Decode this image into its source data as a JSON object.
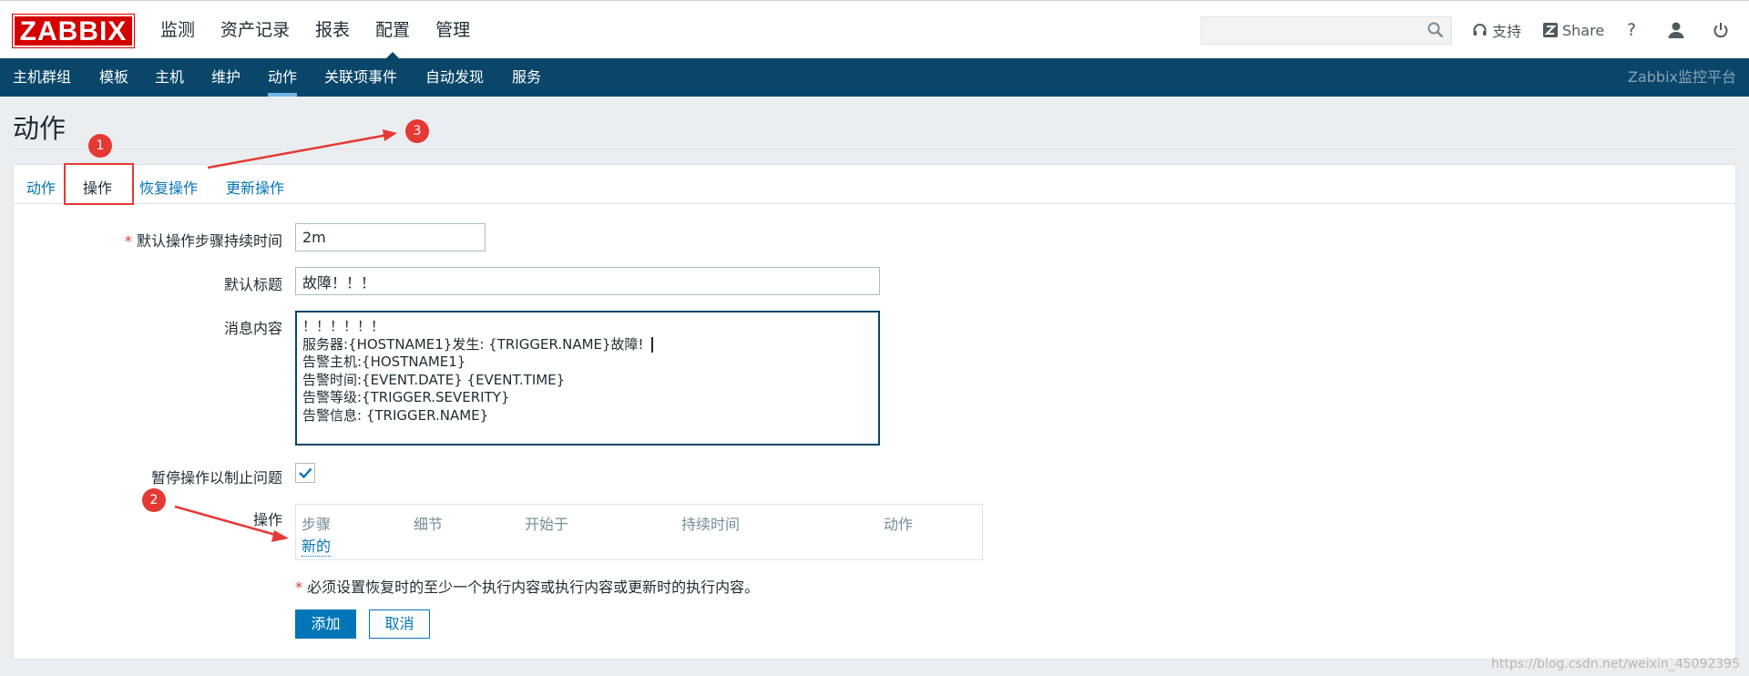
{
  "logo": "ZABBIX",
  "main_menu": [
    "监测",
    "资产记录",
    "报表",
    "配置",
    "管理"
  ],
  "main_menu_active": "配置",
  "search": {
    "value": "",
    "icon": "search-icon"
  },
  "header_tools": {
    "support": "支持",
    "share": "Share",
    "help": "?"
  },
  "sub_menu": [
    "主机群组",
    "模板",
    "主机",
    "维护",
    "动作",
    "关联项事件",
    "自动发现",
    "服务"
  ],
  "sub_menu_active": "动作",
  "platform_name": "Zabbix监控平台",
  "page_title": "动作",
  "tabs": [
    "动作",
    "操作",
    "恢复操作",
    "更新操作"
  ],
  "active_tab": "操作",
  "form": {
    "duration_label": "默认操作步骤持续时间",
    "duration_value": "2m",
    "subject_label": "默认标题",
    "subject_value": "故障！！！",
    "message_label": "消息内容",
    "message_lines": [
      "！！！！！！",
      "服务器:{HOSTNAME1}发生: {TRIGGER.NAME}故障!",
      "告警主机:{HOSTNAME1}",
      "告警时间:{EVENT.DATE} {EVENT.TIME}",
      "告警等级:{TRIGGER.SEVERITY}",
      "告警信息: {TRIGGER.NAME}"
    ],
    "pause_label": "暂停操作以制止问题",
    "pause_checked": true,
    "operations_label": "操作",
    "operations_columns": [
      "步骤",
      "细节",
      "开始于",
      "持续时间",
      "动作"
    ],
    "new_link": "新的",
    "note": "必须设置恢复时的至少一个执行内容或执行内容或更新时的执行内容。",
    "add_button": "添加",
    "cancel_button": "取消"
  },
  "annotations": [
    "1",
    "2",
    "3"
  ],
  "colors": {
    "brand_red": "#d40000",
    "nav_blue": "#0a466a",
    "link_blue": "#0275b8",
    "annotation_red": "#e53935"
  },
  "watermark": "https://blog.csdn.net/weixin_45092395"
}
